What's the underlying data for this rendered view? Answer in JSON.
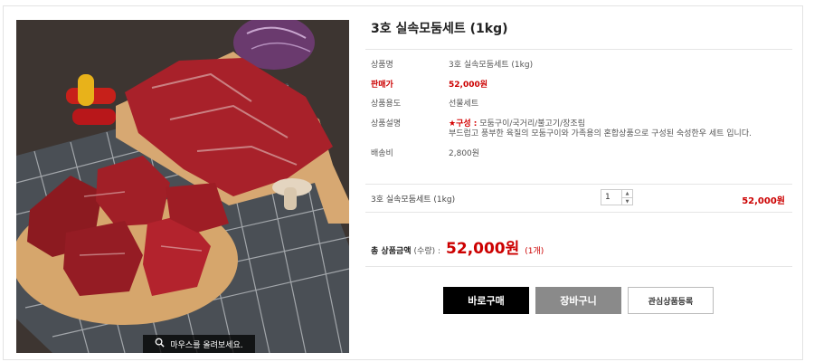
{
  "product": {
    "title": "3호 실속모둠세트 (1kg)",
    "zoom_hint": "마우스를 올려보세요.",
    "fields": [
      {
        "label": "상품명",
        "value": "3호 실속모둠세트 (1kg)"
      },
      {
        "label": "판매가",
        "value": "52,000원"
      },
      {
        "label": "상품용도",
        "value": "선물세트"
      },
      {
        "label": "상품설명",
        "highlight": "★구성 :",
        "value_line1": "모둠구이/국거리/불고기/장조림",
        "value_line2": "부드럽고 풍부한 육질의 모둠구이와 가족용의 혼합상품으로 구성된 숙성한우 세트 입니다."
      },
      {
        "label": "배송비",
        "value": "2,800원"
      }
    ]
  },
  "option": {
    "name": "3호 실속모둠세트 (1kg)",
    "quantity": "1",
    "price": "52,000원"
  },
  "total": {
    "label": "총 상품금액",
    "sub": "(수량) :",
    "amount": "52,000원",
    "count": "(1개)"
  },
  "buttons": {
    "buy": "바로구매",
    "cart": "장바구니",
    "wish": "관심상품등록"
  },
  "colors": {
    "accent_red": "#cc0000",
    "buy_bg": "#000000",
    "cart_bg": "#8a8a8a"
  }
}
